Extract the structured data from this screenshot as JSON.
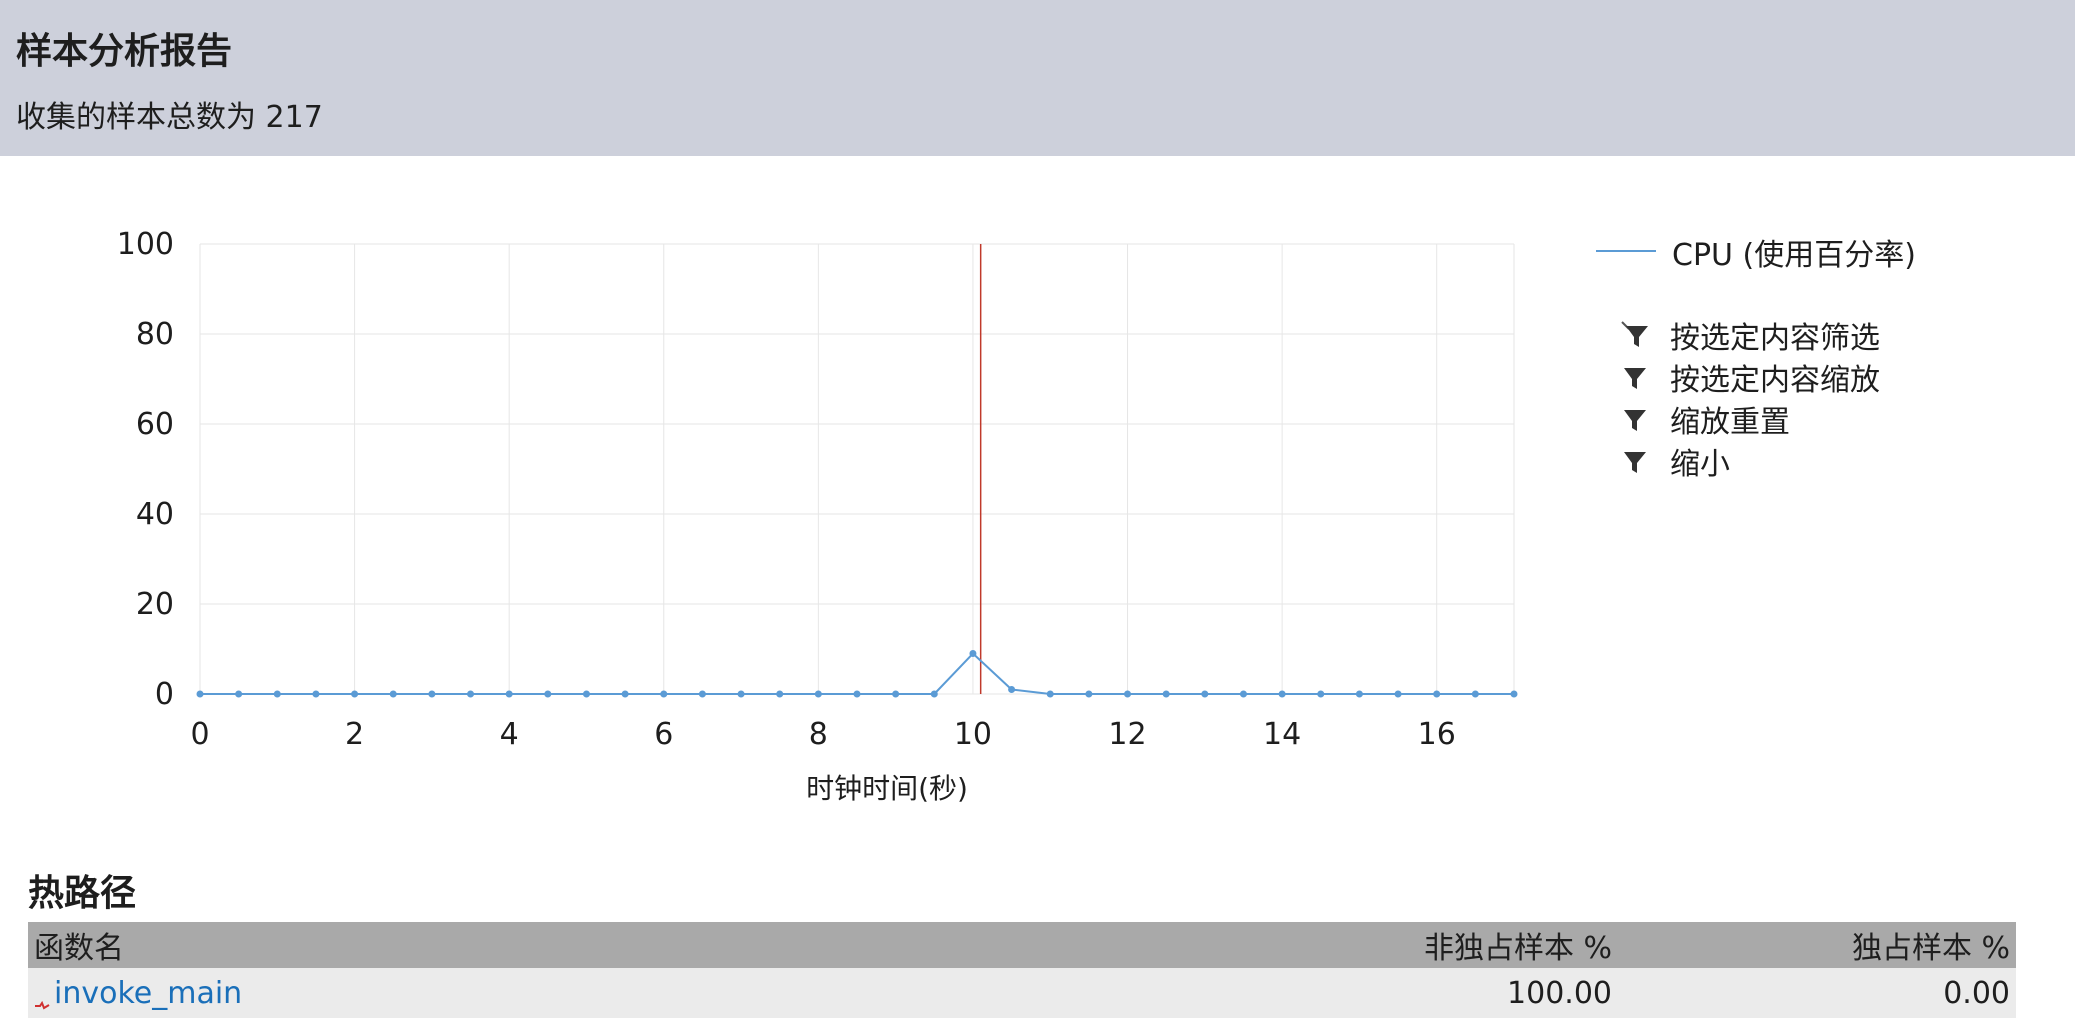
{
  "header": {
    "title": "样本分析报告",
    "sample_total": "收集的样本总数为 217"
  },
  "legend": {
    "series_label": "CPU (使用百分率)",
    "series_color": "#5b9bd5"
  },
  "actions": [
    {
      "label": "按选定内容筛选",
      "icon": "filter-selection-icon"
    },
    {
      "label": "按选定内容缩放",
      "icon": "filter-icon"
    },
    {
      "label": "缩放重置",
      "icon": "filter-icon"
    },
    {
      "label": "缩小",
      "icon": "filter-icon"
    }
  ],
  "chart_data": {
    "type": "line",
    "title": "",
    "xlabel": "时钟时间(秒)",
    "ylabel": "",
    "xlim": [
      0,
      17
    ],
    "ylim": [
      0,
      100
    ],
    "x_ticks": [
      0,
      2,
      4,
      6,
      8,
      10,
      12,
      14,
      16
    ],
    "y_ticks": [
      0,
      20,
      40,
      60,
      80,
      100
    ],
    "grid": true,
    "legend_position": "right",
    "series": [
      {
        "name": "CPU (使用百分率)",
        "color": "#5b9bd5",
        "x": [
          0,
          0.5,
          1,
          1.5,
          2,
          2.5,
          3,
          3.5,
          4,
          4.5,
          5,
          5.5,
          6,
          6.5,
          7,
          7.5,
          8,
          8.5,
          9,
          9.5,
          10,
          10.5,
          11,
          11.5,
          12,
          12.5,
          13,
          13.5,
          14,
          14.5,
          15,
          15.5,
          16,
          16.5,
          17
        ],
        "y": [
          0,
          0,
          0,
          0,
          0,
          0,
          0,
          0,
          0,
          0,
          0,
          0,
          0,
          0,
          0,
          0,
          0,
          0,
          0,
          0,
          9,
          1,
          0,
          0,
          0,
          0,
          0,
          0,
          0,
          0,
          0,
          0,
          0,
          0,
          0
        ]
      }
    ],
    "marker": {
      "x": 10.1,
      "color": "#c0392b"
    }
  },
  "hot_path": {
    "title": "热路径",
    "columns": [
      "函数名",
      "非独占样本 %",
      "独占样本 %"
    ],
    "rows": [
      {
        "name": "invoke_main",
        "inclusive": "100.00",
        "exclusive": "0.00"
      }
    ]
  }
}
